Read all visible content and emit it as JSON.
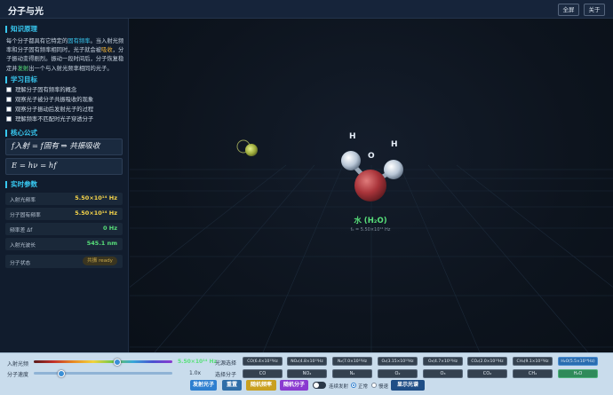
{
  "header": {
    "title": "分子与光",
    "fullscreen_label": "全屏",
    "about_label": "关于"
  },
  "sidebar": {
    "knowledge": {
      "heading": "知识原理",
      "t1": "每个分子都具有它特定的",
      "t1c": "固有频率",
      "t2": "。当入射光频率",
      "t3": "和分子固有频率相同时，光子就会被",
      "t3o": "吸收",
      "t4": "，分子振",
      "t5": "动变得剧烈。振动一段时间后，分子恢复稳定并",
      "t5g": "发",
      "t6g": "射",
      "t6": "出一个与入射光频率相同的光子。"
    },
    "goals": {
      "heading": "学习目标",
      "items": [
        "理解分子固有频率的概念",
        "观察光子被分子共振吸收的现象",
        "观察分子振动后发射光子的过程",
        "理解频率不匹配时光子穿透分子"
      ]
    },
    "formulas": {
      "heading": "核心公式",
      "f1": "f入射 = f固有 ⇒ 共振吸收",
      "f2": "E = hν = hf"
    },
    "realtime": {
      "heading": "实时参数",
      "rows": [
        {
          "label": "入射光频率",
          "value": "5.50×10¹⁴ Hz",
          "color": "#f5d44a"
        },
        {
          "label": "分子固有频率",
          "value": "5.50×10¹⁴ Hz",
          "color": "#f5d44a"
        },
        {
          "label": "频率差 Δf",
          "value": "0 Hz",
          "color": "#58e07a"
        },
        {
          "label": "入射光波长",
          "value": "545.1 nm",
          "color": "#58e07a"
        },
        {
          "label": "分子状态",
          "value": "共振 ready",
          "color": "#c9a94a"
        }
      ]
    }
  },
  "scene": {
    "atom_h1": "H",
    "atom_o": "O",
    "atom_h2": "H",
    "molecule_name": "水 (H₂O)",
    "molecule_freq": "f₀ = 5.50×10¹⁴ Hz"
  },
  "controls": {
    "freq_label": "入射光频",
    "freq_value": "5.50×10¹⁴ Hz",
    "freq_level": 0.6,
    "speed_label": "分子速度",
    "speed_value": "1.0x",
    "speed_level": 0.2,
    "preset_label": "光源选择",
    "molecule_label": "选择分子",
    "presets": [
      "CO(6.4×10¹³Hz",
      "NO₂(4.8×10¹³Hz",
      "N₂(7.0×10¹³Hz",
      "O₂(3.15×10¹³Hz",
      "O₃(4.7×10¹³Hz",
      "CO₂(2.0×10¹³Hz",
      "CH₄(9.1×10¹³Hz",
      "H₂O(5.5×10¹⁴Hz)"
    ],
    "molecules": [
      "CO",
      "NO₂",
      "N₂",
      "O₂",
      "O₃",
      "CO₂",
      "CH₄",
      "H₂O"
    ],
    "fire_label": "发射光子",
    "reset_label": "重置",
    "random_freq_label": "随机频率",
    "random_mol_label": "随机分子",
    "continuous_label": "连续发射",
    "normal_label": "正常",
    "slow_label": "慢速",
    "hint_label": "显示光谱",
    "accent": "#3a8fd6"
  }
}
